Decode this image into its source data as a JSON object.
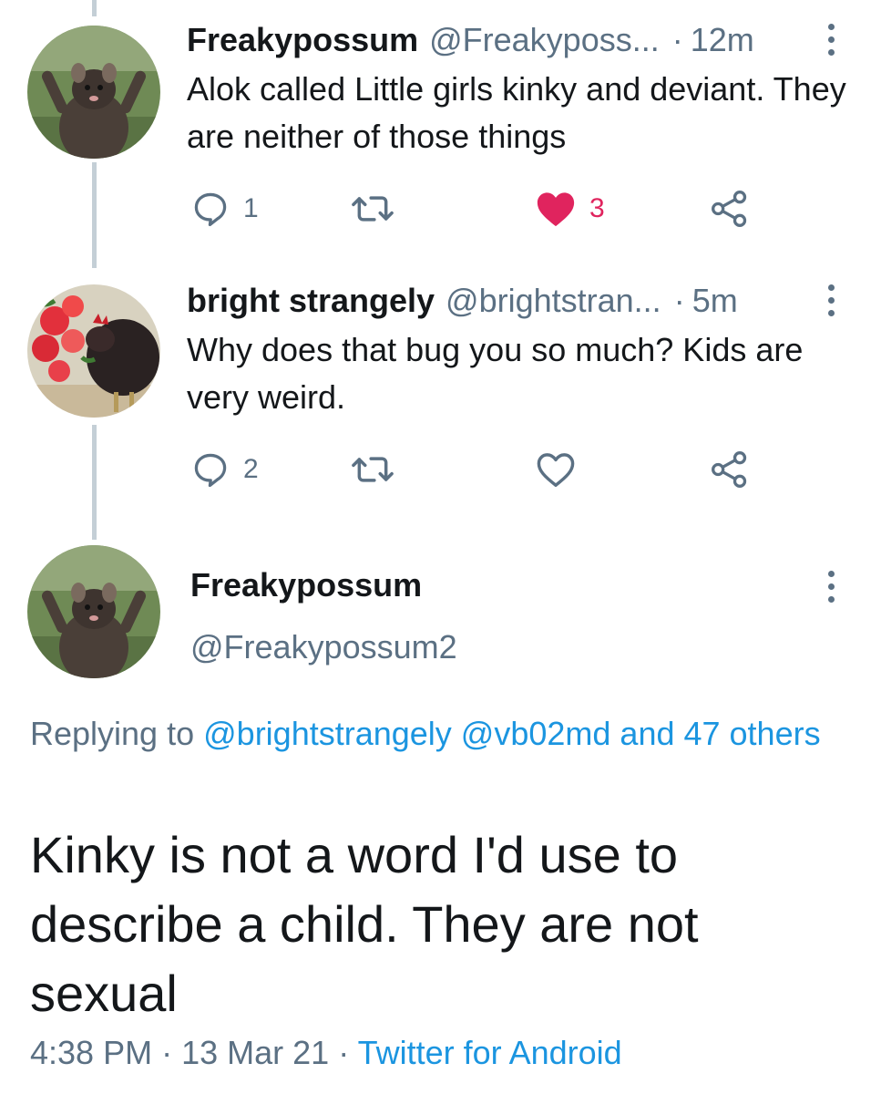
{
  "tweets": [
    {
      "name": "Freakypossum",
      "handle": "@Freakyposs...",
      "separator": "·",
      "time": "12m",
      "text": "Alok called Little girls kinky and deviant. They are neither of those things",
      "reply_count": "1",
      "retweet_count": "",
      "like_count": "3",
      "liked": true,
      "avatar_icon": "possum-avatar"
    },
    {
      "name": "bright strangely",
      "handle": "@brightstran...",
      "separator": "·",
      "time": "5m",
      "text": "Why does that bug you so much? Kids are very weird.",
      "reply_count": "2",
      "retweet_count": "",
      "like_count": "",
      "liked": false,
      "avatar_icon": "rooster-flowers-avatar"
    }
  ],
  "main_tweet": {
    "name": "Freakypossum",
    "handle": "@Freakypossum2",
    "replying_prefix": "Replying to",
    "replying_mentions": "@brightstrangely @vb02md and 47 others",
    "text": "Kinky is not a word I'd use to describe a child. They are not sexual",
    "time": "4:38 PM",
    "separator": "·",
    "date": "13 Mar 21",
    "source": "Twitter for Android"
  },
  "colors": {
    "text": "#14171a",
    "secondary": "#5b7083",
    "link": "#1b95e0",
    "like": "#e0245e",
    "thread_line": "#c4cfd6"
  }
}
